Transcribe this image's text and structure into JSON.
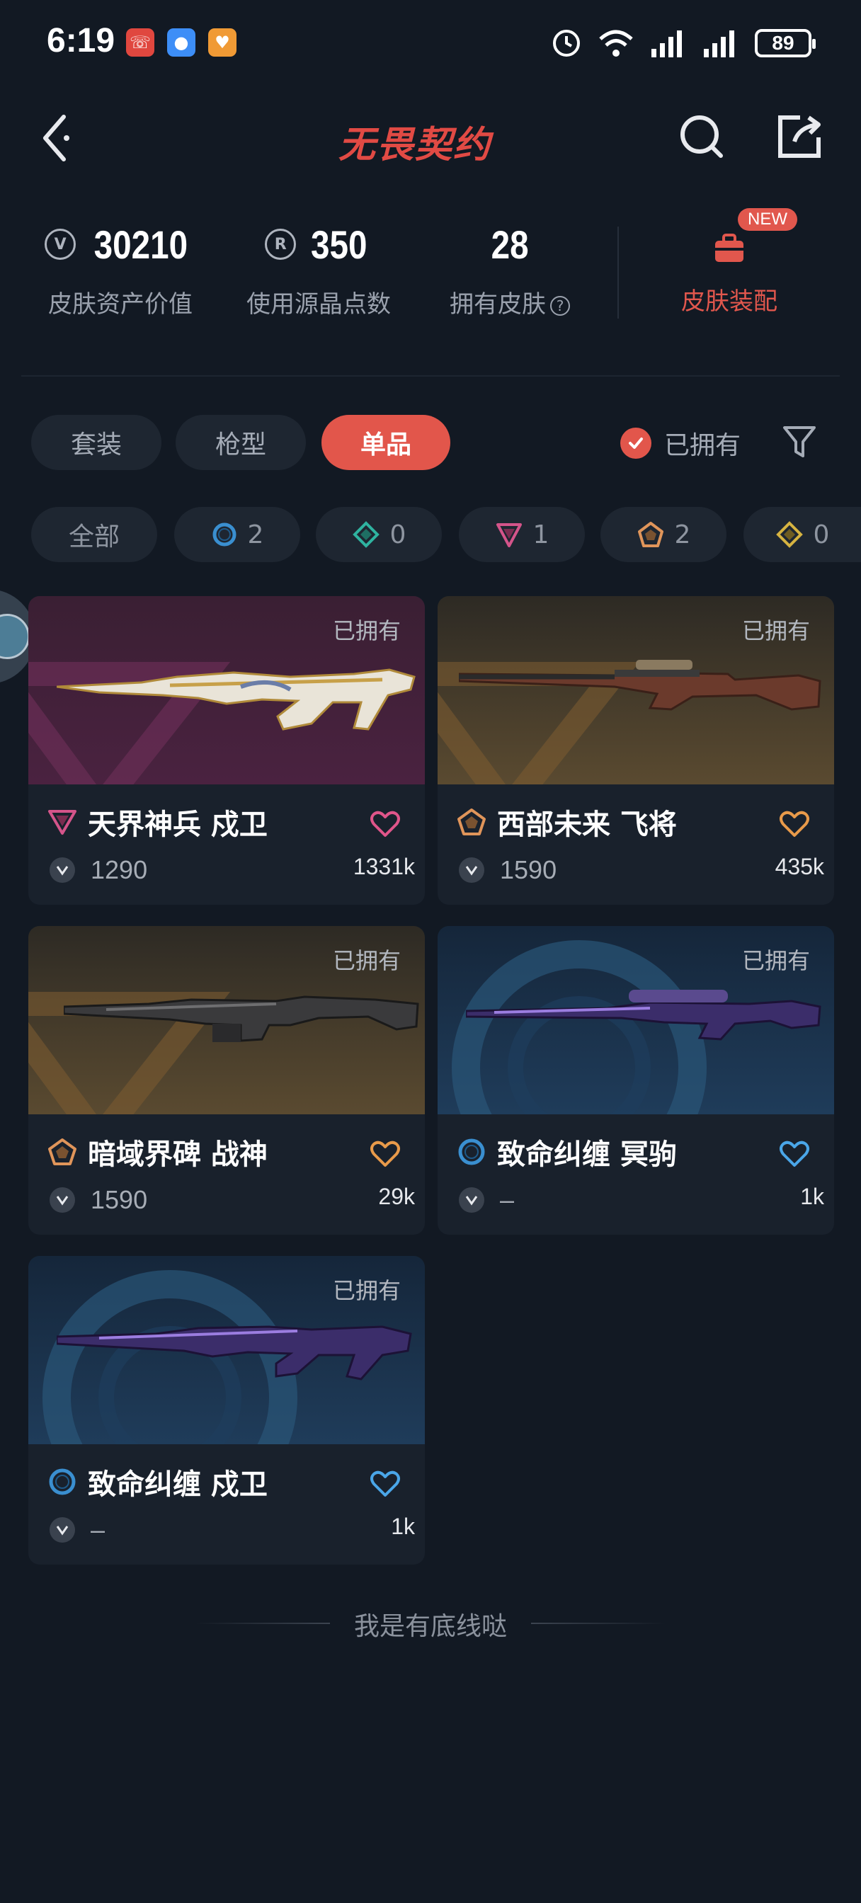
{
  "status_bar": {
    "time": "6:19",
    "battery": "89"
  },
  "header": {
    "title": "无畏契约"
  },
  "stats": {
    "asset_value": "30210",
    "asset_label": "皮肤资产价值",
    "points": "350",
    "points_label": "使用源晶点数",
    "skins_owned": "28",
    "skins_owned_label": "拥有皮肤",
    "equip_badge": "NEW",
    "equip_label": "皮肤装配"
  },
  "tabs": [
    {
      "label": "套装",
      "active": false
    },
    {
      "label": "枪型",
      "active": false
    },
    {
      "label": "单品",
      "active": true
    }
  ],
  "owned_filter": {
    "label": "已拥有",
    "checked": true
  },
  "rarity_chips": [
    {
      "label": "全部",
      "color": ""
    },
    {
      "count": "2",
      "color": "#3a8fd0"
    },
    {
      "count": "0",
      "color": "#2fb3a0"
    },
    {
      "count": "1",
      "color": "#d4548a"
    },
    {
      "count": "2",
      "color": "#e0955a"
    },
    {
      "count": "0",
      "color": "#d6b341"
    }
  ],
  "cards": [
    {
      "owned_label": "已拥有",
      "name": "天界神兵 戍卫",
      "price": "1290",
      "likes": "1331k",
      "rarity_color": "#d4548a",
      "heart_color": "#e0558a"
    },
    {
      "owned_label": "已拥有",
      "name": "西部未来 飞将",
      "price": "1590",
      "likes": "435k",
      "rarity_color": "#e0955a",
      "heart_color": "#e89a4a"
    },
    {
      "owned_label": "已拥有",
      "name": "暗域界碑 战神",
      "price": "1590",
      "likes": "29k",
      "rarity_color": "#e0955a",
      "heart_color": "#e89a4a"
    },
    {
      "owned_label": "已拥有",
      "name": "致命纠缠 冥驹",
      "price": "–",
      "likes": "1k",
      "rarity_color": "#3a8fd0",
      "heart_color": "#4aa6e8"
    },
    {
      "owned_label": "已拥有",
      "name": "致命纠缠 戍卫",
      "price": "–",
      "likes": "1k",
      "rarity_color": "#3a8fd0",
      "heart_color": "#4aa6e8"
    }
  ],
  "footer": {
    "text": "我是有底线哒"
  }
}
